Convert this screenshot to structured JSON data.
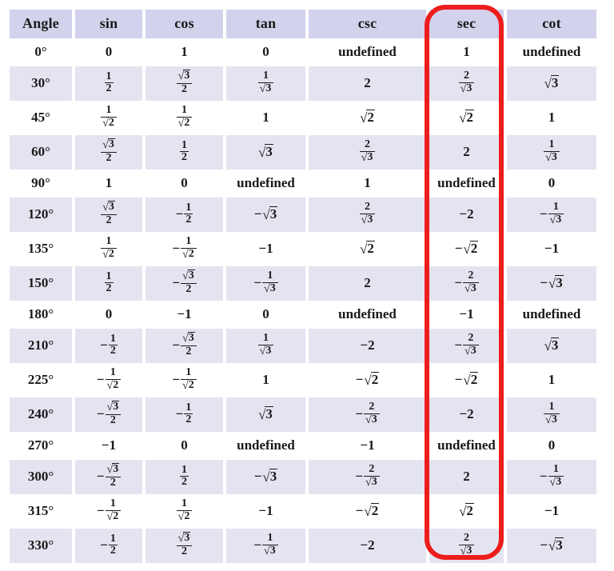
{
  "table": {
    "name": "trigonometric-function-values",
    "columns": [
      "Angle",
      "sin",
      "cos",
      "tan",
      "csc",
      "sec",
      "cot"
    ],
    "rows": [
      {
        "angle": "0°",
        "cells": [
          {
            "kind": "plain",
            "text": "0"
          },
          {
            "kind": "plain",
            "text": "1"
          },
          {
            "kind": "plain",
            "text": "0"
          },
          {
            "kind": "word",
            "text": "undefined"
          },
          {
            "kind": "plain",
            "text": "1"
          },
          {
            "kind": "word",
            "text": "undefined"
          }
        ]
      },
      {
        "angle": "30°",
        "cells": [
          {
            "kind": "frac",
            "num": "1",
            "den": "2"
          },
          {
            "kind": "frac",
            "num": "√3",
            "den": "2"
          },
          {
            "kind": "frac",
            "num": "1",
            "den": "√3"
          },
          {
            "kind": "plain",
            "text": "2"
          },
          {
            "kind": "frac",
            "num": "2",
            "den": "√3"
          },
          {
            "kind": "sqrt",
            "radicand": "3"
          }
        ]
      },
      {
        "angle": "45°",
        "cells": [
          {
            "kind": "frac",
            "num": "1",
            "den": "√2"
          },
          {
            "kind": "frac",
            "num": "1",
            "den": "√2"
          },
          {
            "kind": "plain",
            "text": "1"
          },
          {
            "kind": "sqrt",
            "radicand": "2"
          },
          {
            "kind": "sqrt",
            "radicand": "2"
          },
          {
            "kind": "plain",
            "text": "1"
          }
        ]
      },
      {
        "angle": "60°",
        "cells": [
          {
            "kind": "frac",
            "num": "√3",
            "den": "2"
          },
          {
            "kind": "frac",
            "num": "1",
            "den": "2"
          },
          {
            "kind": "sqrt",
            "radicand": "3"
          },
          {
            "kind": "frac",
            "num": "2",
            "den": "√3"
          },
          {
            "kind": "plain",
            "text": "2"
          },
          {
            "kind": "frac",
            "num": "1",
            "den": "√3"
          }
        ]
      },
      {
        "angle": "90°",
        "cells": [
          {
            "kind": "plain",
            "text": "1"
          },
          {
            "kind": "plain",
            "text": "0"
          },
          {
            "kind": "word",
            "text": "undefined"
          },
          {
            "kind": "plain",
            "text": "1"
          },
          {
            "kind": "word",
            "text": "undefined"
          },
          {
            "kind": "plain",
            "text": "0"
          }
        ]
      },
      {
        "angle": "120°",
        "cells": [
          {
            "kind": "frac",
            "num": "√3",
            "den": "2"
          },
          {
            "kind": "frac",
            "num": "1",
            "den": "2",
            "neg": true
          },
          {
            "kind": "sqrt",
            "radicand": "3",
            "neg": true
          },
          {
            "kind": "frac",
            "num": "2",
            "den": "√3"
          },
          {
            "kind": "plain",
            "text": "−2"
          },
          {
            "kind": "frac",
            "num": "1",
            "den": "√3",
            "neg": true
          }
        ]
      },
      {
        "angle": "135°",
        "cells": [
          {
            "kind": "frac",
            "num": "1",
            "den": "√2"
          },
          {
            "kind": "frac",
            "num": "1",
            "den": "√2",
            "neg": true
          },
          {
            "kind": "plain",
            "text": "−1"
          },
          {
            "kind": "sqrt",
            "radicand": "2"
          },
          {
            "kind": "sqrt",
            "radicand": "2",
            "neg": true
          },
          {
            "kind": "plain",
            "text": "−1"
          }
        ]
      },
      {
        "angle": "150°",
        "cells": [
          {
            "kind": "frac",
            "num": "1",
            "den": "2"
          },
          {
            "kind": "frac",
            "num": "√3",
            "den": "2",
            "neg": true
          },
          {
            "kind": "frac",
            "num": "1",
            "den": "√3",
            "neg": true
          },
          {
            "kind": "plain",
            "text": "2"
          },
          {
            "kind": "frac",
            "num": "2",
            "den": "√3",
            "neg": true
          },
          {
            "kind": "sqrt",
            "radicand": "3",
            "neg": true
          }
        ]
      },
      {
        "angle": "180°",
        "cells": [
          {
            "kind": "plain",
            "text": "0"
          },
          {
            "kind": "plain",
            "text": "−1"
          },
          {
            "kind": "plain",
            "text": "0"
          },
          {
            "kind": "word",
            "text": "undefined"
          },
          {
            "kind": "plain",
            "text": "−1"
          },
          {
            "kind": "word",
            "text": "undefined"
          }
        ]
      },
      {
        "angle": "210°",
        "cells": [
          {
            "kind": "frac",
            "num": "1",
            "den": "2",
            "neg": true
          },
          {
            "kind": "frac",
            "num": "√3",
            "den": "2",
            "neg": true
          },
          {
            "kind": "frac",
            "num": "1",
            "den": "√3"
          },
          {
            "kind": "plain",
            "text": "−2"
          },
          {
            "kind": "frac",
            "num": "2",
            "den": "√3",
            "neg": true
          },
          {
            "kind": "sqrt",
            "radicand": "3"
          }
        ]
      },
      {
        "angle": "225°",
        "cells": [
          {
            "kind": "frac",
            "num": "1",
            "den": "√2",
            "neg": true
          },
          {
            "kind": "frac",
            "num": "1",
            "den": "√2",
            "neg": true
          },
          {
            "kind": "plain",
            "text": "1"
          },
          {
            "kind": "sqrt",
            "radicand": "2",
            "neg": true
          },
          {
            "kind": "sqrt",
            "radicand": "2",
            "neg": true
          },
          {
            "kind": "plain",
            "text": "1"
          }
        ]
      },
      {
        "angle": "240°",
        "cells": [
          {
            "kind": "frac",
            "num": "√3",
            "den": "2",
            "neg": true
          },
          {
            "kind": "frac",
            "num": "1",
            "den": "2",
            "neg": true
          },
          {
            "kind": "sqrt",
            "radicand": "3"
          },
          {
            "kind": "frac",
            "num": "2",
            "den": "√3",
            "neg": true
          },
          {
            "kind": "plain",
            "text": "−2"
          },
          {
            "kind": "frac",
            "num": "1",
            "den": "√3"
          }
        ]
      },
      {
        "angle": "270°",
        "cells": [
          {
            "kind": "plain",
            "text": "−1"
          },
          {
            "kind": "plain",
            "text": "0"
          },
          {
            "kind": "word",
            "text": "undefined"
          },
          {
            "kind": "plain",
            "text": "−1"
          },
          {
            "kind": "word",
            "text": "undefined"
          },
          {
            "kind": "plain",
            "text": "0"
          }
        ]
      },
      {
        "angle": "300°",
        "cells": [
          {
            "kind": "frac",
            "num": "√3",
            "den": "2",
            "neg": true
          },
          {
            "kind": "frac",
            "num": "1",
            "den": "2"
          },
          {
            "kind": "sqrt",
            "radicand": "3",
            "neg": true
          },
          {
            "kind": "frac",
            "num": "2",
            "den": "√3",
            "neg": true
          },
          {
            "kind": "plain",
            "text": "2"
          },
          {
            "kind": "frac",
            "num": "1",
            "den": "√3",
            "neg": true
          }
        ]
      },
      {
        "angle": "315°",
        "cells": [
          {
            "kind": "frac",
            "num": "1",
            "den": "√2",
            "neg": true
          },
          {
            "kind": "frac",
            "num": "1",
            "den": "√2"
          },
          {
            "kind": "plain",
            "text": "−1"
          },
          {
            "kind": "sqrt",
            "radicand": "2",
            "neg": true
          },
          {
            "kind": "sqrt",
            "radicand": "2"
          },
          {
            "kind": "plain",
            "text": "−1"
          }
        ]
      },
      {
        "angle": "330°",
        "cells": [
          {
            "kind": "frac",
            "num": "1",
            "den": "2",
            "neg": true
          },
          {
            "kind": "frac",
            "num": "√3",
            "den": "2"
          },
          {
            "kind": "frac",
            "num": "1",
            "den": "√3",
            "neg": true
          },
          {
            "kind": "plain",
            "text": "−2"
          },
          {
            "kind": "frac",
            "num": "2",
            "den": "√3"
          },
          {
            "kind": "sqrt",
            "radicand": "3",
            "neg": true
          }
        ]
      }
    ]
  },
  "annotation": {
    "name": "sec-column-highlight",
    "shape": "rounded-rectangle",
    "target_column": "sec",
    "color": "#ee1c1c"
  },
  "colors": {
    "header_background": "#d2d2ec",
    "row_shaded_background": "#e4e4f1",
    "row_plain_background": "#ffffff",
    "text": "#1a1a1a",
    "annotation": "#ee1c1c"
  }
}
